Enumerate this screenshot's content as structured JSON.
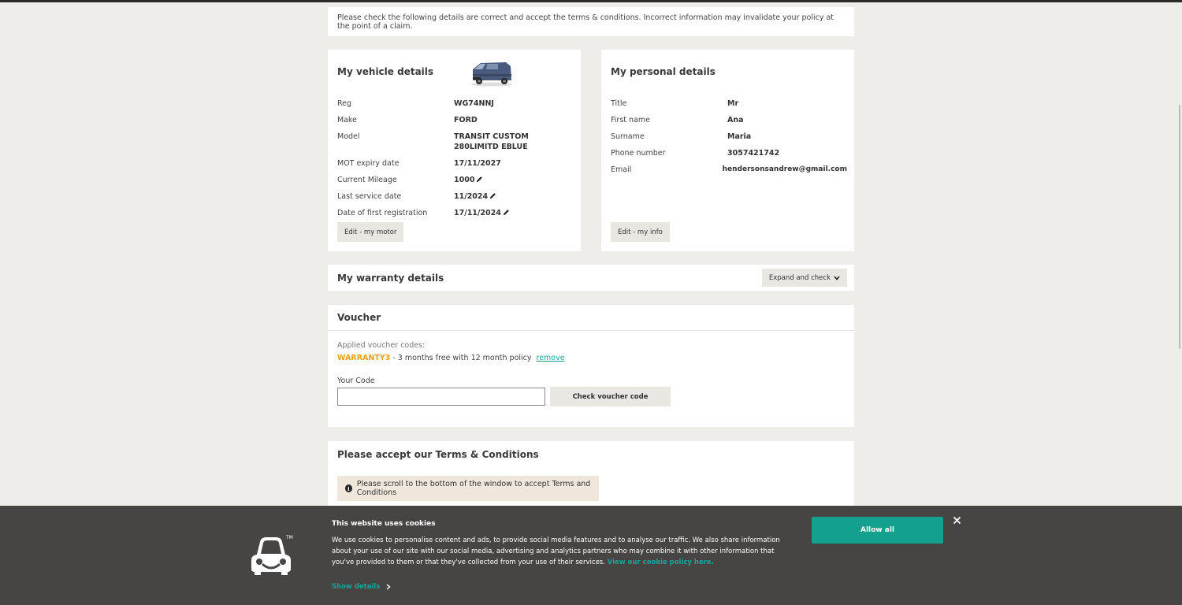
{
  "notice": "Please check the following details are correct and accept the terms & conditions. Incorrect information may invalidate your policy at the point of a claim.",
  "vehicle": {
    "title": "My vehicle details",
    "rows": [
      {
        "label": "Reg",
        "value": "WG74NNJ"
      },
      {
        "label": "Make",
        "value": "FORD"
      },
      {
        "label": "Model",
        "value": "TRANSIT CUSTOM 280LIMITD EBLUE"
      },
      {
        "label": "MOT expiry date",
        "value": "17/11/2027"
      },
      {
        "label": "Current Mileage",
        "value": "1000"
      },
      {
        "label": "Last service date",
        "value": "11/2024"
      },
      {
        "label": "Date of first registration",
        "value": "17/11/2024"
      }
    ],
    "edit_button": "Edit - my motor"
  },
  "personal": {
    "title": "My personal details",
    "rows": [
      {
        "label": "Title",
        "value": "Mr"
      },
      {
        "label": "First name",
        "value": "Ana"
      },
      {
        "label": "Surname",
        "value": "Maria"
      },
      {
        "label": "Phone number",
        "value": "3057421742"
      },
      {
        "label": "Email",
        "value": "hendersonsandrew@gmail.com"
      }
    ],
    "edit_button": "Edit - my info"
  },
  "warranty": {
    "title": "My warranty details",
    "expand_button": "Expand and check"
  },
  "voucher": {
    "title": "Voucher",
    "applied_label": "Applied voucher codes:",
    "code": "WARRANTY3",
    "description": " - 3 months free with 12 month policy",
    "remove_link": "remove",
    "your_code_label": "Your Code",
    "input_value": "",
    "check_button": "Check voucher code"
  },
  "terms": {
    "title": "Please accept our Terms & Conditions",
    "alert": "Please scroll to the bottom of the window to accept Terms and Conditions"
  },
  "cookie": {
    "title": "This website uses cookies",
    "text": "We use cookies to personalise content and ads, to provide social media features and to analyse our traffic. We also share information about your use of our site with our social media, advertising and analytics partners who may combine it with other information that you've provided to them or that they've collected from your use of their services.",
    "policy_link": "View our cookie policy here.",
    "show_details": "Show details",
    "allow_button": "Allow all",
    "logo_mark": "TM"
  },
  "colors": {
    "accent": "#14a08e",
    "voucher_code": "#e3a21a",
    "banner_bg": "#474444",
    "page_bg": "#eeede9"
  }
}
